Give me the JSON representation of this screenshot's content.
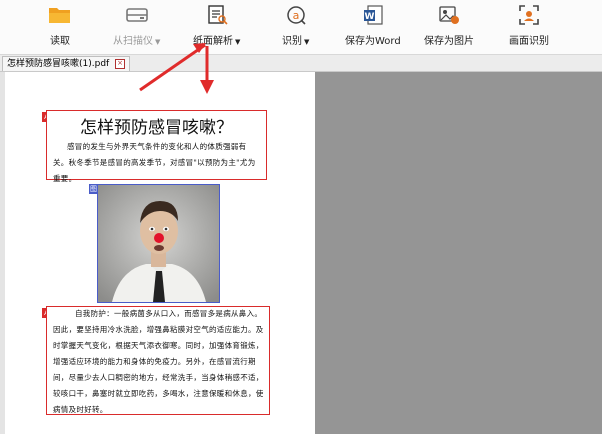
{
  "toolbar": {
    "read": "读取",
    "scan": "从扫描仪",
    "parse": "纸面解析",
    "recognize": "识别",
    "save_word": "保存为Word",
    "save_image": "保存为图片",
    "screen_recognize": "画面识别"
  },
  "tab": {
    "filename": "怎样预防感冒咳嗽(1).pdf"
  },
  "document": {
    "title": "怎样预防感冒咳嗽？",
    "para1": "感冒的发生与外界天气条件的变化和人的体质强弱有关。秋冬季节是感冒的高发季节，对感冒\"以预防为主\"尤为重要。",
    "para2": "自我防护：一般病菌多从口入，而感冒多是病从鼻入。因此，要坚持用冷水洗脸，增强鼻粘膜对空气的适应能力。及时掌握天气变化，根据天气添衣御寒。同时，加强体育锻炼，增强适应环境的能力和身体的免疫力。另外，在感冒流行期间，尽量少去人口稠密的地方，经常洗手，当身体稍感不适，较咳口干，鼻塞时就立即吃药，多喝水，注意保暖和休息，使病情及时好转。"
  },
  "markers": {
    "text": "A",
    "image": "图"
  },
  "colors": {
    "text_region_border": "#d92b2b",
    "image_region_border": "#4a5cc8",
    "arrow": "#e02b2b"
  }
}
